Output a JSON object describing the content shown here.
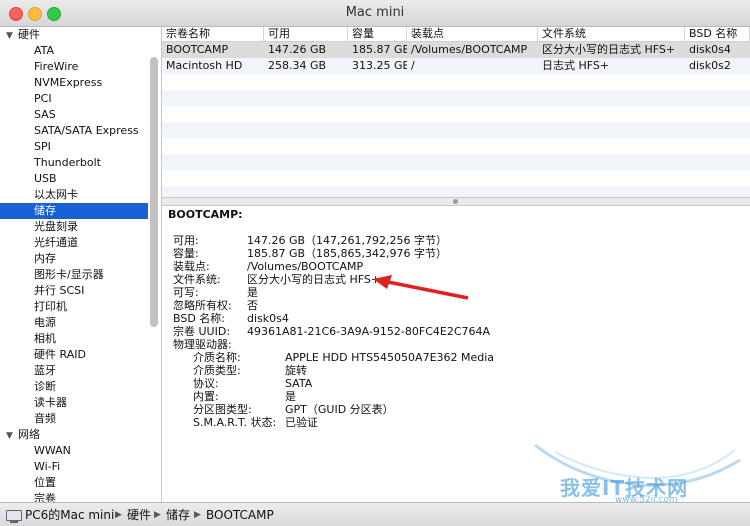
{
  "window": {
    "title": "Mac mini"
  },
  "sidebar": {
    "sections": [
      {
        "label": "硬件",
        "items": [
          "ATA",
          "FireWire",
          "NVMExpress",
          "PCI",
          "SAS",
          "SATA/SATA Express",
          "SPI",
          "Thunderbolt",
          "USB",
          "以太网卡",
          "储存",
          "光盘刻录",
          "光纤通道",
          "内存",
          "图形卡/显示器",
          "并行 SCSI",
          "打印机",
          "电源",
          "相机",
          "硬件 RAID",
          "蓝牙",
          "诊断",
          "读卡器",
          "音频"
        ]
      },
      {
        "label": "网络",
        "items": [
          "WWAN",
          "Wi-Fi",
          "位置",
          "宗卷"
        ]
      }
    ],
    "selected": "储存"
  },
  "table": {
    "headers": [
      "宗卷名称",
      "可用",
      "容量",
      "装载点",
      "文件系统",
      "BSD 名称"
    ],
    "rows": [
      [
        "BOOTCAMP",
        "147.26 GB",
        "185.87 GB",
        "/Volumes/BOOTCAMP",
        "区分大小写的日志式 HFS+",
        "disk0s4"
      ],
      [
        "Macintosh HD",
        "258.34 GB",
        "313.25 GB",
        "/",
        "日志式 HFS+",
        "disk0s2"
      ]
    ],
    "selected_row": 0
  },
  "detail": {
    "title": "BOOTCAMP:",
    "fields": [
      {
        "k": "可用:",
        "v": "147.26 GB（147,261,792,256 字节）"
      },
      {
        "k": "容量:",
        "v": "185.87 GB（185,865,342,976 字节）"
      },
      {
        "k": "装载点:",
        "v": "/Volumes/BOOTCAMP"
      },
      {
        "k": "文件系统:",
        "v": "区分大小写的日志式 HFS+"
      },
      {
        "k": "可写:",
        "v": "是"
      },
      {
        "k": "忽略所有权:",
        "v": "否"
      },
      {
        "k": "BSD 名称:",
        "v": "disk0s4"
      },
      {
        "k": "宗卷 UUID:",
        "v": "49361A81-21C6-3A9A-9152-80FC4E2C764A"
      },
      {
        "k": "物理驱动器:",
        "v": ""
      }
    ],
    "sub_fields": [
      {
        "k": "介质名称:",
        "v": "APPLE HDD HTS545050A7E362 Media"
      },
      {
        "k": "介质类型:",
        "v": "旋转"
      },
      {
        "k": "协议:",
        "v": "SATA"
      },
      {
        "k": "内置:",
        "v": "是"
      },
      {
        "k": "分区图类型:",
        "v": "GPT（GUID 分区表）"
      },
      {
        "k": "S.M.A.R.T. 状态:",
        "v": "已验证"
      }
    ]
  },
  "breadcrumb": [
    "PC6的Mac mini",
    "硬件",
    "储存",
    "BOOTCAMP"
  ],
  "watermark": {
    "text": "我爱IT技术网",
    "url": "www.52ij.com"
  },
  "colors": {
    "selection": "#1860d6",
    "arrow": "#e02020",
    "watermark": "#2a8fd8"
  }
}
